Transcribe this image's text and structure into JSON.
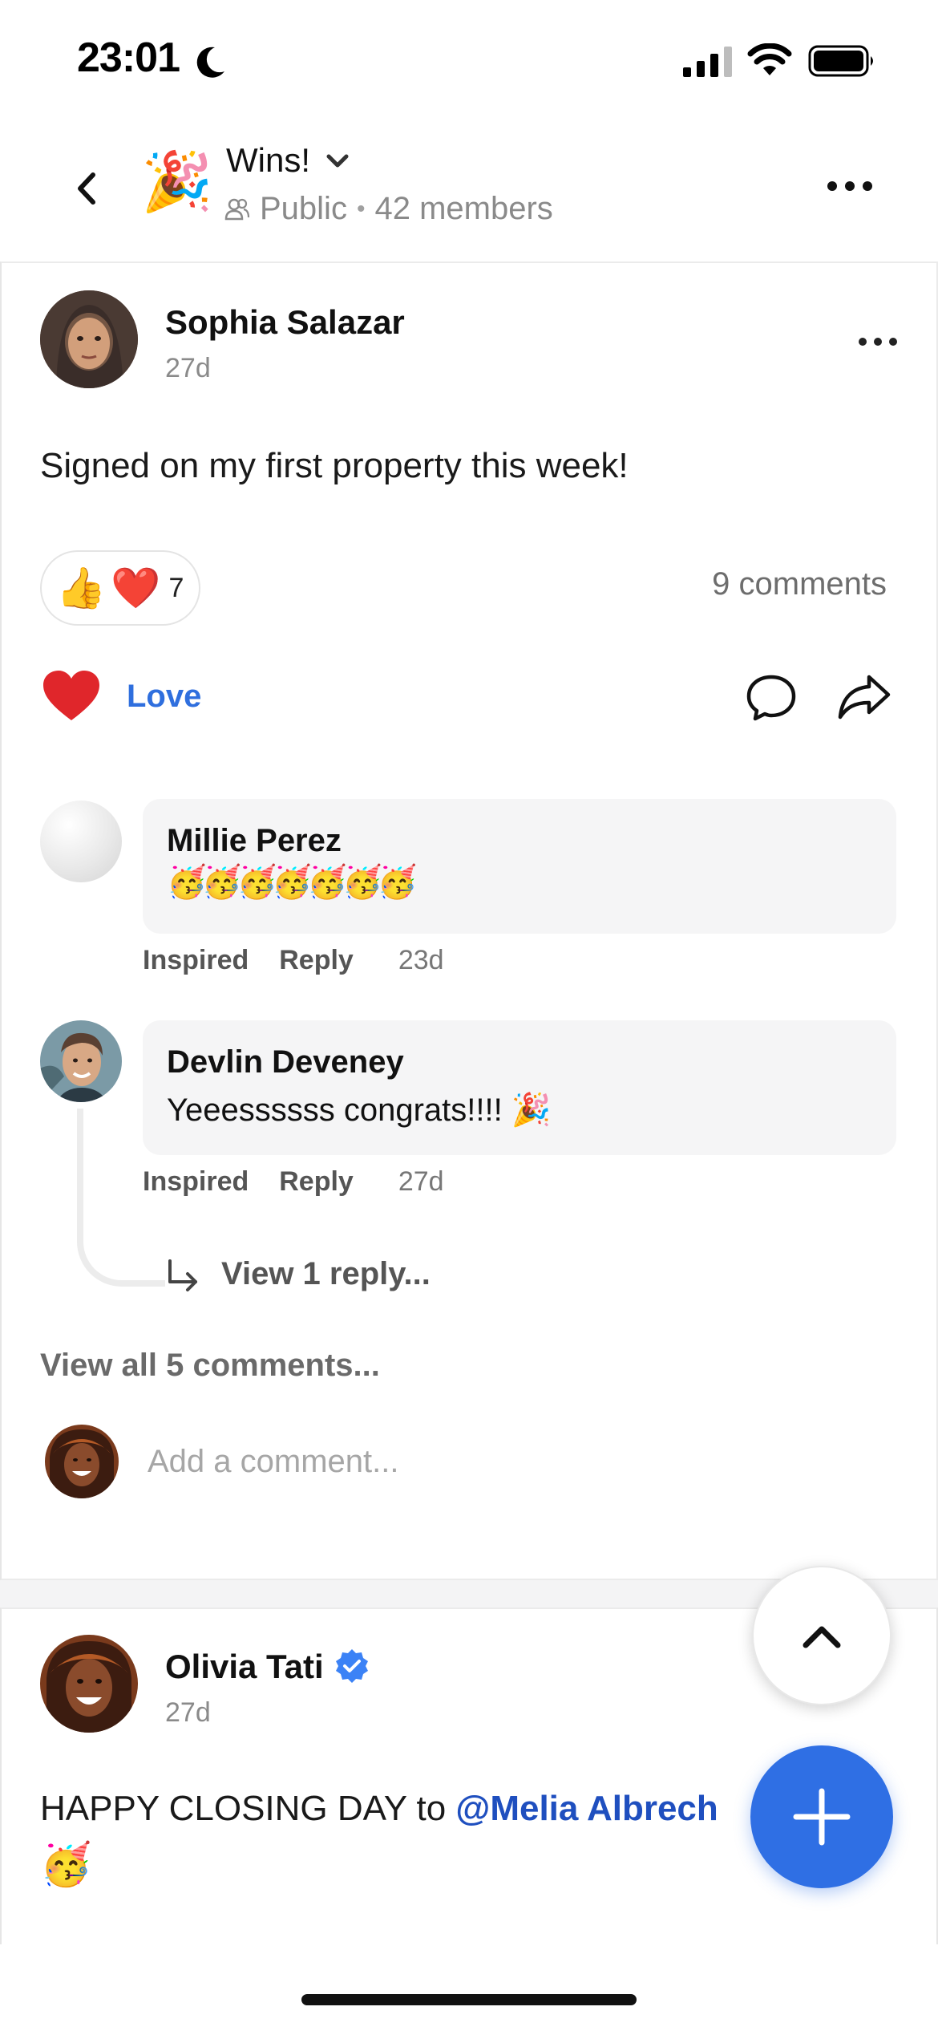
{
  "status_bar": {
    "time": "23:01"
  },
  "header": {
    "group_emoji": "🎉",
    "title": "Wins!",
    "visibility": "Public",
    "separator": "•",
    "members": "42 members"
  },
  "post1": {
    "author": "Sophia Salazar",
    "time": "27d",
    "text": "Signed on my first property this week!",
    "reactions": {
      "emojis": [
        "👍",
        "❤️"
      ],
      "count": "7"
    },
    "comments_count": "9 comments",
    "love_label": "Love",
    "comments": [
      {
        "author": "Millie Perez",
        "text": "🥳🥳🥳🥳🥳🥳🥳",
        "actions": [
          "Inspired",
          "Reply"
        ],
        "time": "23d"
      },
      {
        "author": "Devlin Deveney",
        "text": "Yeeessssss congrats!!!! 🎉",
        "actions": [
          "Inspired",
          "Reply"
        ],
        "time": "27d"
      }
    ],
    "view_reply": "View 1 reply...",
    "view_all": "View all 5 comments...",
    "add_comment_placeholder": "Add a comment..."
  },
  "post2": {
    "author": "Olivia Tati",
    "time": "27d",
    "text_prefix": "HAPPY CLOSING DAY to ",
    "mention": "@Melia Albrech",
    "emoji_line": "🥳"
  },
  "colors": {
    "accent": "#2f6fe4",
    "love": "#2f6fde",
    "mention": "#1f4fbf",
    "heart": "#e0262b"
  }
}
